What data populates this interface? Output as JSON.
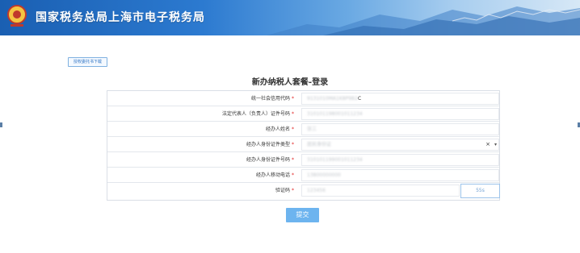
{
  "header": {
    "title": "国家税务总局上海市电子税务局"
  },
  "toolbar": {
    "download_label": "授权委托书下载"
  },
  "form": {
    "title": "新办纳税人套餐-登录",
    "required_mark": "*",
    "fields": [
      {
        "label": "统一社会信用代码",
        "value_hidden": "9131010MA1K8P9B2",
        "value_tail": "C"
      },
      {
        "label": "法定代表人（负责人）证件号码",
        "value_hidden": "310101198001011234"
      },
      {
        "label": "经办人姓名",
        "value_hidden": "张三"
      },
      {
        "label": "经办人身份证件类型",
        "value_hidden": "居民身份证",
        "clear_glyph": "×",
        "caret_glyph": "▾"
      },
      {
        "label": "经办人身份证件号码",
        "value_hidden": "310101199001011234"
      },
      {
        "label": "经办人移动电话",
        "value_hidden": "13800000000"
      },
      {
        "label": "验证码",
        "value_hidden": "123456"
      }
    ],
    "captcha_countdown": "55s",
    "submit_label": "提交"
  },
  "colors": {
    "banner_start": "#1a5fb2",
    "accent": "#2d73c4",
    "submit_bg": "#6db4ef",
    "required": "#e02020"
  }
}
